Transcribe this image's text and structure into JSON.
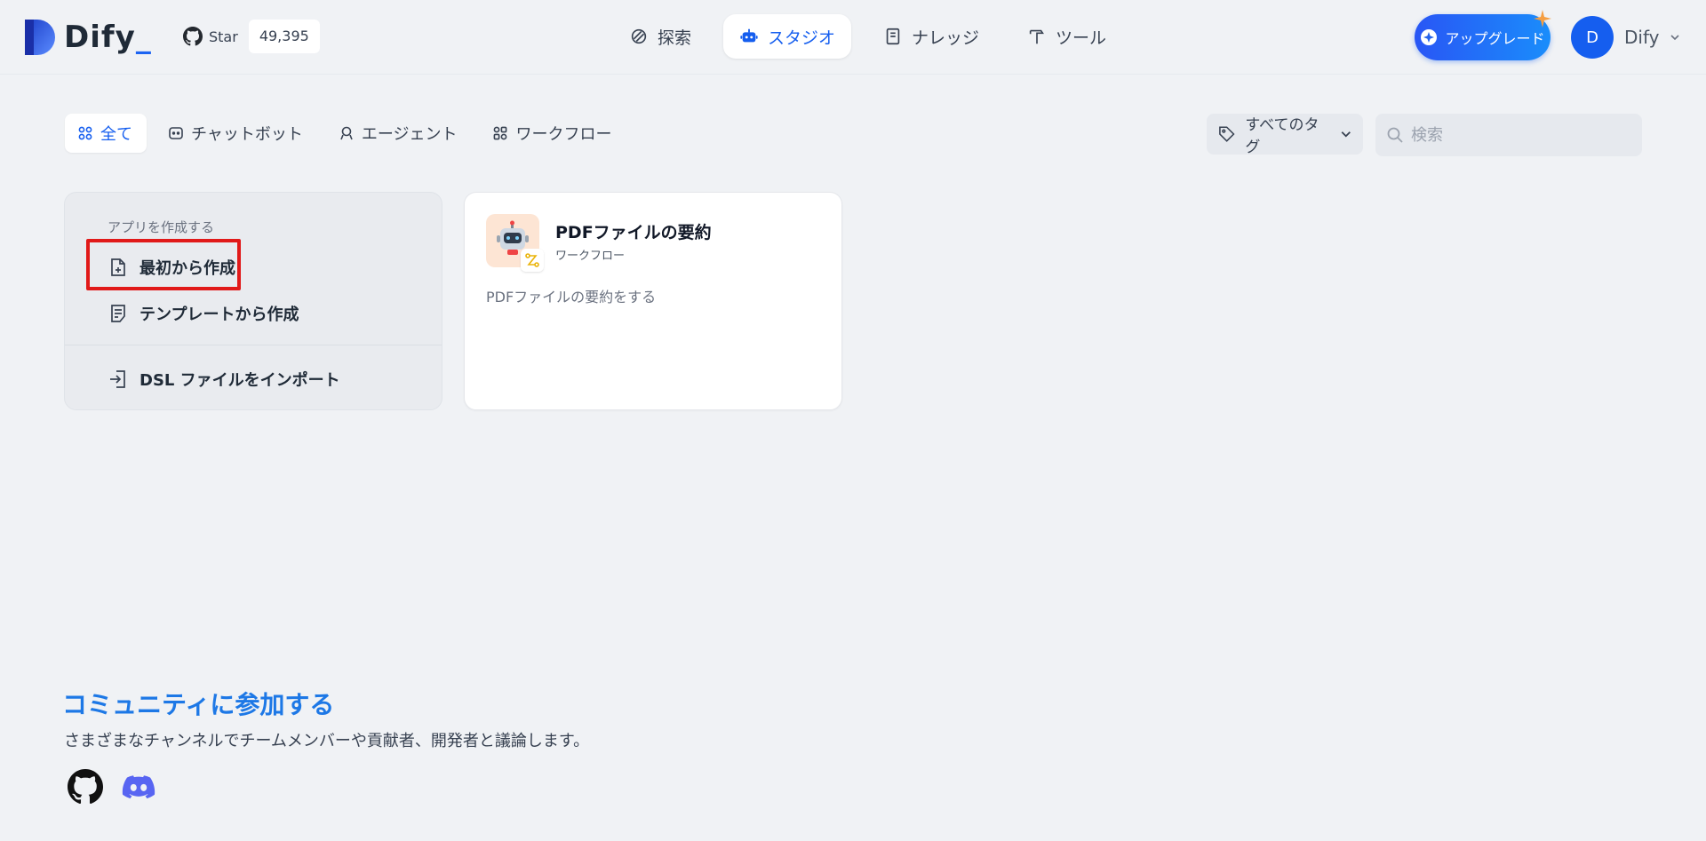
{
  "header": {
    "logo_text": "Dify",
    "logo_suffix": "_",
    "github": {
      "star_label": "Star",
      "star_count": "49,395"
    },
    "nav": [
      {
        "label": "探索",
        "icon": "compass-icon"
      },
      {
        "label": "スタジオ",
        "icon": "robot-icon",
        "active": true
      },
      {
        "label": "ナレッジ",
        "icon": "book-icon"
      },
      {
        "label": "ツール",
        "icon": "hammer-icon"
      }
    ],
    "upgrade_label": "アップグレード",
    "user": {
      "avatar_initial": "D",
      "name": "Dify"
    }
  },
  "filters": {
    "tabs": [
      {
        "label": "全て",
        "icon": "grid-icon",
        "active": true
      },
      {
        "label": "チャットボット",
        "icon": "chat-icon"
      },
      {
        "label": "エージェント",
        "icon": "agent-icon"
      },
      {
        "label": "ワークフロー",
        "icon": "workflow-icon"
      }
    ],
    "tag_filter_label": "すべてのタグ",
    "search_placeholder": "検索"
  },
  "create_card": {
    "heading": "アプリを作成する",
    "items": [
      {
        "label": "最初から作成",
        "icon": "file-plus-icon"
      },
      {
        "label": "テンプレートから作成",
        "icon": "template-icon"
      },
      {
        "label": "DSL ファイルをインポート",
        "icon": "import-icon"
      }
    ]
  },
  "apps": [
    {
      "title": "PDFファイルの要約",
      "type": "ワークフロー",
      "description": "PDFファイルの要約をする",
      "icon": "robot-avatar-icon",
      "icon_bg": "#fde5d4"
    }
  ],
  "community": {
    "title": "コミュニティに参加する",
    "description": "さまざまなチャンネルでチームメンバーや貢献者、開発者と議論します。",
    "links": [
      "github-icon",
      "discord-icon"
    ]
  },
  "colors": {
    "accent": "#155eef",
    "highlight": "#e11919",
    "community_title": "#1d78e6"
  }
}
